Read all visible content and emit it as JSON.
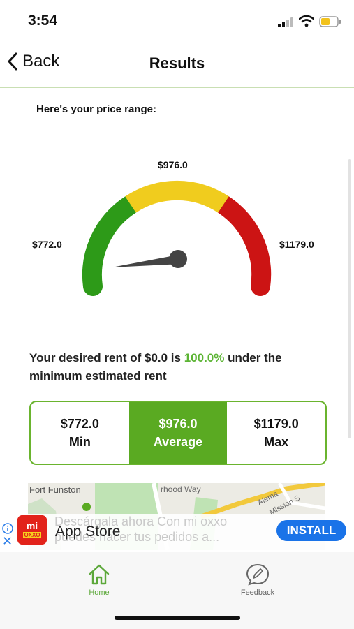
{
  "status": {
    "time": "3:54"
  },
  "nav": {
    "back_label": "Back",
    "title": "Results"
  },
  "price_range": {
    "heading": "Here's your price range:",
    "min_label": "$772.0",
    "avg_label": "$976.0",
    "max_label": "$1179.0",
    "needle_level": 0.0
  },
  "desired": {
    "text_before": "Your desired rent of $0.0 is ",
    "percent": "100.0%",
    "text_after": " under the minimum estimated rent"
  },
  "summary": [
    {
      "value": "$772.0",
      "label": "Min"
    },
    {
      "value": "$976.0",
      "label": "Average"
    },
    {
      "value": "$1179.0",
      "label": "Max"
    }
  ],
  "map": {
    "place": "Fort Funston",
    "street": "rhood Way",
    "street2": "Alema",
    "street3": "Mission S"
  },
  "ad": {
    "description": "Descárgala ahora Con mi oxxo puedes hacer tus pedidos a...",
    "app_name": "App Store",
    "install_label": "INSTALL",
    "logo_text": "mi oxxo"
  },
  "tabs": {
    "home": "Home",
    "feedback": "Feedback"
  },
  "colors": {
    "accent": "#5aaa22",
    "gauge_green": "#2d9a18",
    "gauge_yellow": "#f0cc1e",
    "gauge_red": "#cc1414",
    "install_blue": "#1a73e8"
  }
}
